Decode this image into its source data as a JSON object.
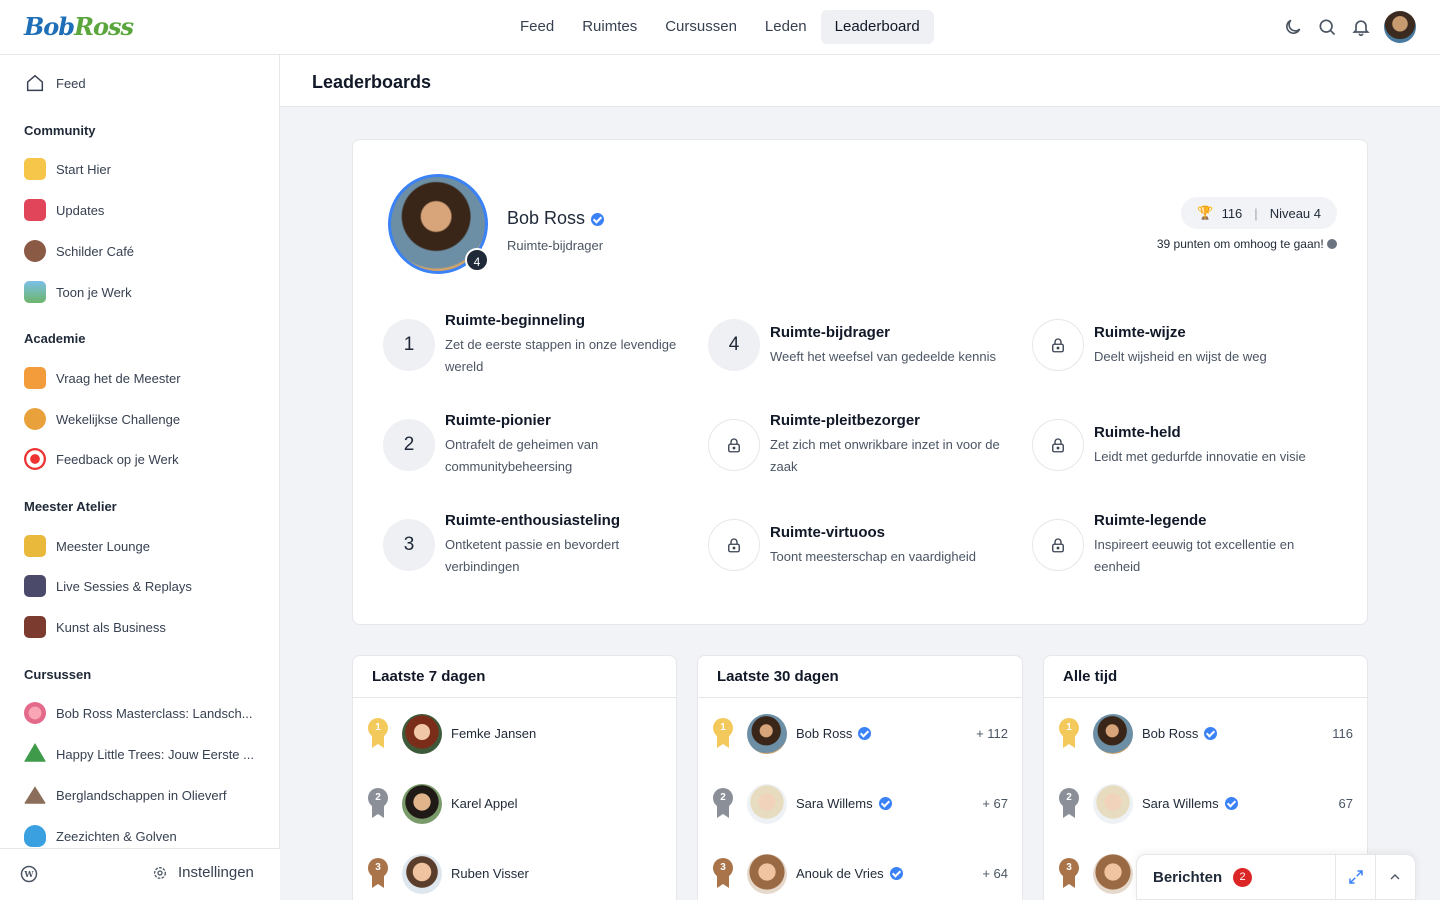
{
  "brand": {
    "part1": "Bob",
    "part2": "Ross"
  },
  "topnav": [
    "Feed",
    "Ruimtes",
    "Cursussen",
    "Leden",
    "Leaderboard"
  ],
  "sidebar": {
    "feed": "Feed",
    "groups": [
      {
        "title": "Community",
        "items": [
          "Start Hier",
          "Updates",
          "Schilder Café",
          "Toon je Werk"
        ]
      },
      {
        "title": "Academie",
        "items": [
          "Vraag het de Meester",
          "Wekelijkse Challenge",
          "Feedback op je Werk"
        ]
      },
      {
        "title": "Meester Atelier",
        "items": [
          "Meester Lounge",
          "Live Sessies & Replays",
          "Kunst als Business"
        ]
      },
      {
        "title": "Cursussen",
        "items": [
          "Bob Ross Masterclass: Landsch...",
          "Happy Little Trees: Jouw Eerste ...",
          "Berglandschappen in Olieverf",
          "Zeezichten & Golven"
        ]
      }
    ],
    "settings": "Instellingen"
  },
  "page_title": "Leaderboards",
  "profile": {
    "name": "Bob Ross",
    "role": "Ruimte-bijdrager",
    "level_badge": "4",
    "points": "116",
    "level": "Niveau 4",
    "note": "39 punten om omhoog te gaan!"
  },
  "levels": [
    {
      "num": "1",
      "title": "Ruimte-beginneling",
      "desc": "Zet de eerste stappen in onze levendige wereld"
    },
    {
      "num": "4",
      "title": "Ruimte-bijdrager",
      "desc": "Weeft het weefsel van gedeelde kennis"
    },
    {
      "num": "",
      "title": "Ruimte-wijze",
      "desc": "Deelt wijsheid en wijst de weg"
    },
    {
      "num": "2",
      "title": "Ruimte-pionier",
      "desc": "Ontrafelt de geheimen van communitybeheersing"
    },
    {
      "num": "",
      "title": "Ruimte-pleitbezorger",
      "desc": "Zet zich met onwrikbare inzet in voor de zaak"
    },
    {
      "num": "",
      "title": "Ruimte-held",
      "desc": "Leidt met gedurfde innovatie en visie"
    },
    {
      "num": "3",
      "title": "Ruimte-enthousiasteling",
      "desc": "Ontketent passie en bevordert verbindingen"
    },
    {
      "num": "",
      "title": "Ruimte-virtuoos",
      "desc": "Toont meesterschap en vaardigheid"
    },
    {
      "num": "",
      "title": "Ruimte-legende",
      "desc": "Inspireert eeuwig tot excellentie en eenheid"
    }
  ],
  "boards": [
    {
      "title": "Laatste 7 dagen",
      "rows": [
        {
          "rank": "1",
          "name": "Femke Jansen",
          "score": ""
        },
        {
          "rank": "2",
          "name": "Karel Appel",
          "score": ""
        },
        {
          "rank": "3",
          "name": "Ruben Visser",
          "score": ""
        }
      ]
    },
    {
      "title": "Laatste 30 dagen",
      "rows": [
        {
          "rank": "1",
          "name": "Bob Ross",
          "score": "+ 112"
        },
        {
          "rank": "2",
          "name": "Sara Willems",
          "score": "+ 67"
        },
        {
          "rank": "3",
          "name": "Anouk de Vries",
          "score": "+ 64"
        }
      ]
    },
    {
      "title": "Alle tijd",
      "rows": [
        {
          "rank": "1",
          "name": "Bob Ross",
          "score": "116"
        },
        {
          "rank": "2",
          "name": "Sara Willems",
          "score": "67"
        },
        {
          "rank": "3",
          "name": "",
          "score": ""
        }
      ]
    }
  ],
  "messages": {
    "label": "Berichten",
    "count": "2"
  },
  "colors": {
    "accent": "#3b82f6",
    "gold": "#f3c95b",
    "silver": "#8a8f98",
    "bronze": "#a9744a",
    "badge_red": "#dc2626"
  }
}
